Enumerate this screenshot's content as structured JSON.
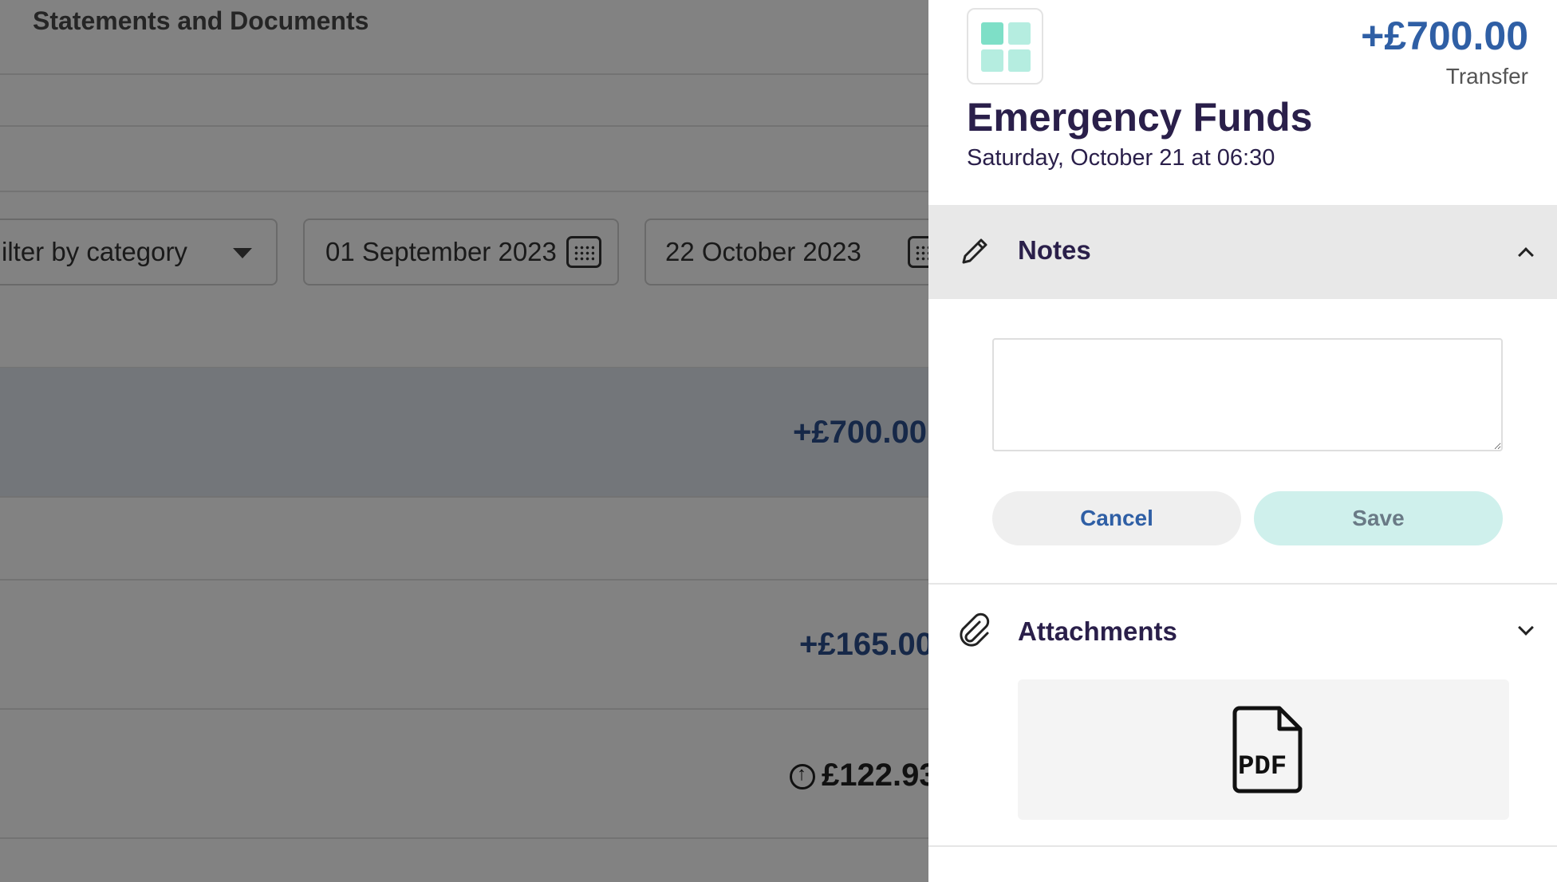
{
  "background": {
    "title": "Statements and Documents",
    "filters": {
      "category_placeholder": "ilter by category",
      "start_date": "01 September 2023",
      "end_date": "22 October 2023"
    },
    "rows": [
      {
        "amount": "+£700.00"
      },
      {
        "amount": "+£165.00"
      },
      {
        "amount": "£122.93"
      }
    ]
  },
  "drawer": {
    "amount": "+£700.00",
    "type": "Transfer",
    "name": "Emergency Funds",
    "datetime": "Saturday, October 21 at 06:30",
    "notes": {
      "title": "Notes",
      "value": "",
      "cancel_label": "Cancel",
      "save_label": "Save"
    },
    "attachments": {
      "title": "Attachments"
    }
  },
  "colors": {
    "accent_blue": "#2f5fa5",
    "heading": "#2a1f4a",
    "save_bg": "#cff0ec",
    "logo_tile": "#7edfc7"
  },
  "icons": [
    "calendar-icon",
    "dropdown-caret-icon",
    "pencil-icon",
    "chevron-up-icon",
    "paperclip-icon",
    "chevron-down-icon",
    "pdf-file-icon",
    "upload-circle-icon"
  ]
}
